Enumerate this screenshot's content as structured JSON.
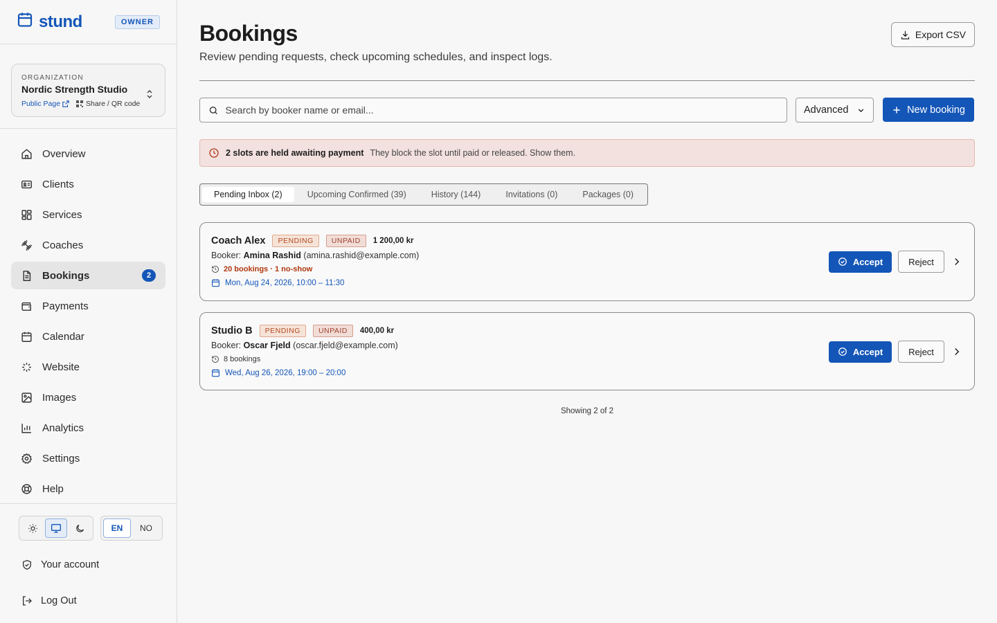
{
  "brand": {
    "name": "stund",
    "role_badge": "OWNER"
  },
  "organization": {
    "label": "ORGANIZATION",
    "name": "Nordic Strength Studio",
    "public_page": "Public Page",
    "share": "Share / QR code"
  },
  "nav": [
    {
      "label": "Overview",
      "icon": "home-icon"
    },
    {
      "label": "Clients",
      "icon": "id-card-icon"
    },
    {
      "label": "Services",
      "icon": "grid-icon"
    },
    {
      "label": "Coaches",
      "icon": "dumbbell-icon"
    },
    {
      "label": "Bookings",
      "icon": "document-icon",
      "active": true,
      "count": "2"
    },
    {
      "label": "Payments",
      "icon": "wallet-icon"
    },
    {
      "label": "Calendar",
      "icon": "calendar-icon"
    },
    {
      "label": "Website",
      "icon": "sparkles-icon"
    },
    {
      "label": "Images",
      "icon": "image-icon"
    },
    {
      "label": "Analytics",
      "icon": "bar-chart-icon"
    },
    {
      "label": "Settings",
      "icon": "gear-icon"
    },
    {
      "label": "Help",
      "icon": "lifebuoy-icon"
    }
  ],
  "prefs": {
    "theme_selected": "system",
    "languages": [
      "EN",
      "NO"
    ],
    "language_selected": "EN"
  },
  "footer": {
    "account": "Your account",
    "logout": "Log Out"
  },
  "header": {
    "title": "Bookings",
    "subtitle": "Review pending requests, check upcoming schedules, and inspect logs.",
    "export": "Export CSV"
  },
  "toolbar": {
    "search_placeholder": "Search by booker name or email...",
    "advanced": "Advanced",
    "new_booking": "New booking"
  },
  "alert": {
    "bold": "2 slots are held awaiting payment",
    "text": "They block the slot until paid or released. Show them."
  },
  "tabs": [
    {
      "label": "Pending Inbox (2)",
      "active": true
    },
    {
      "label": "Upcoming Confirmed (39)"
    },
    {
      "label": "History (144)"
    },
    {
      "label": "Invitations (0)"
    },
    {
      "label": "Packages (0)"
    }
  ],
  "bookings": [
    {
      "coach": "Coach Alex",
      "status": "PENDING",
      "payment": "UNPAID",
      "price": "1 200,00 kr",
      "booker_prefix": "Booker:",
      "booker_name": "Amina Rashid",
      "booker_email": "(amina.rashid@example.com)",
      "history": "20 bookings · 1 no-show",
      "when": "Mon, Aug 24, 2026, 10:00 – 11:30",
      "accept": "Accept",
      "reject": "Reject"
    },
    {
      "coach": "Studio B",
      "status": "PENDING",
      "payment": "UNPAID",
      "price": "400,00 kr",
      "booker_prefix": "Booker:",
      "booker_name": "Oscar Fjeld",
      "booker_email": "(oscar.fjeld@example.com)",
      "history": "8 bookings",
      "when": "Wed, Aug 26, 2026, 19:00 – 20:00",
      "accept": "Accept",
      "reject": "Reject"
    }
  ],
  "showing": "Showing 2 of 2",
  "colors": {
    "accent": "#1456b8",
    "warn": "#b0380f",
    "alert_bg": "#f2e1de"
  }
}
